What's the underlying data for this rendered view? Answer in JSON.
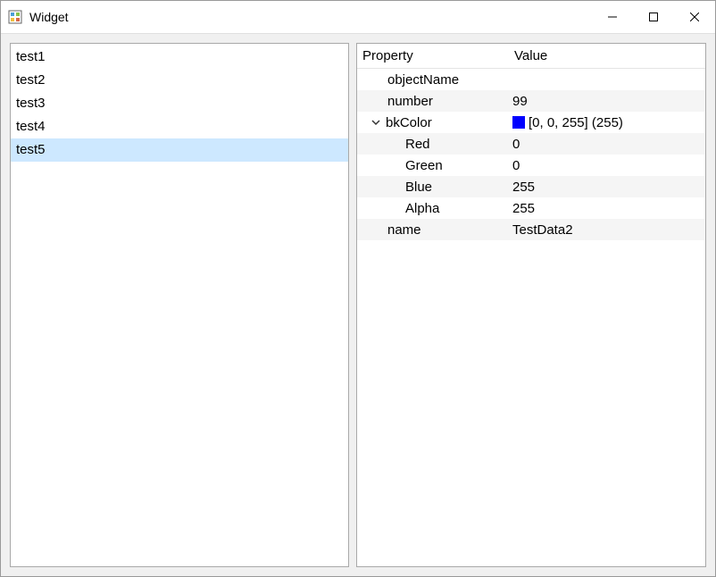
{
  "window": {
    "title": "Widget"
  },
  "list": {
    "items": [
      "test1",
      "test2",
      "test3",
      "test4",
      "test5"
    ],
    "selected_index": 4
  },
  "property_table": {
    "header_key": "Property",
    "header_value": "Value",
    "rows": {
      "objectName": {
        "label": "objectName",
        "value": ""
      },
      "number": {
        "label": "number",
        "value": "99"
      },
      "bkColor": {
        "label": "bkColor",
        "value_text": "[0, 0, 255] (255)",
        "swatch_color": "#0000ff",
        "expanded": true,
        "children": {
          "Red": {
            "label": "Red",
            "value": "0"
          },
          "Green": {
            "label": "Green",
            "value": "0"
          },
          "Blue": {
            "label": "Blue",
            "value": "255"
          },
          "Alpha": {
            "label": "Alpha",
            "value": "255"
          }
        }
      },
      "name": {
        "label": "name",
        "value": "TestData2"
      }
    }
  }
}
